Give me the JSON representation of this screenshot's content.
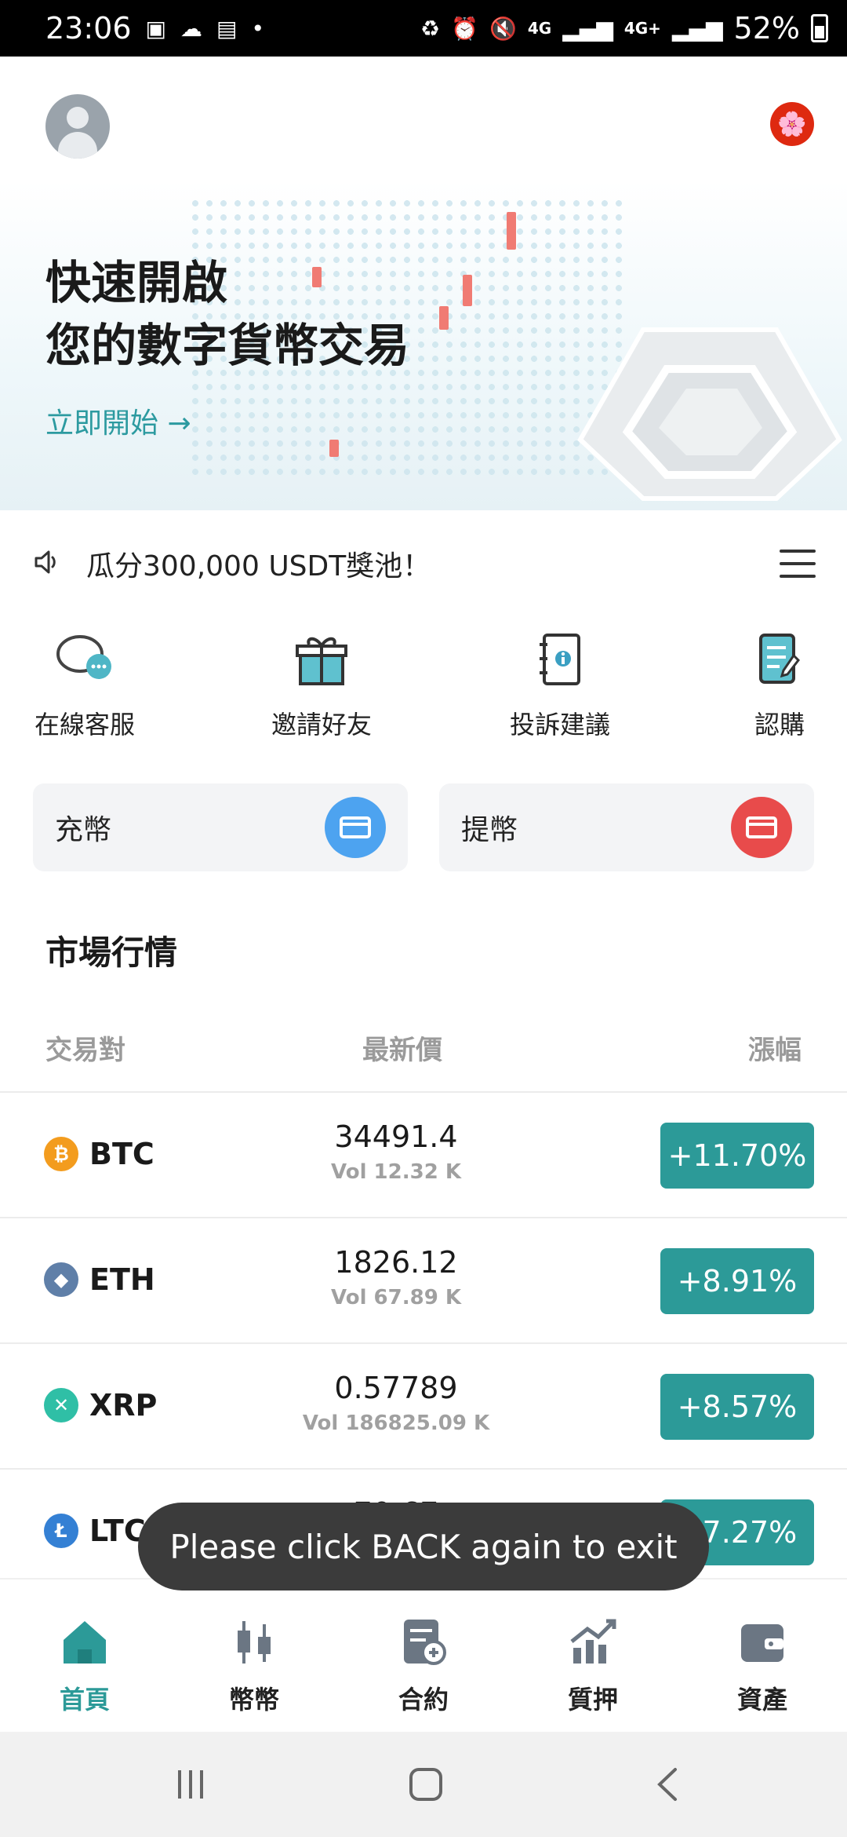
{
  "status_bar": {
    "time": "23:06",
    "network_4g": "4G",
    "network_4g_plus": "4G+",
    "battery": "52%",
    "icons": [
      "image-icon",
      "cloud-icon",
      "sim-icon",
      "dot-icon",
      "recycle-icon",
      "alarm-icon",
      "mute-icon",
      "signal-icon",
      "signal-icon",
      "battery-icon"
    ]
  },
  "header": {
    "avatar_icon": "user-avatar-icon",
    "region_flag": "🌸"
  },
  "banner": {
    "title_line1": "快速開啟",
    "title_line2": "您的數字貨幣交易",
    "cta": "立即開始 →"
  },
  "notice": {
    "text": "瓜分300,000 USDT獎池！",
    "icon": "speaker-icon"
  },
  "quick_actions": [
    {
      "label": "在線客服",
      "icon": "chat-icon"
    },
    {
      "label": "邀請好友",
      "icon": "gift-icon"
    },
    {
      "label": "投訴建議",
      "icon": "notebook-icon"
    },
    {
      "label": "認購",
      "icon": "document-icon"
    }
  ],
  "deposit": {
    "label": "充幣",
    "color": "#4da3f0"
  },
  "withdraw": {
    "label": "提幣",
    "color": "#e84b4b"
  },
  "market": {
    "title": "市場行情",
    "columns": {
      "pair": "交易對",
      "price": "最新價",
      "change": "漲幅"
    },
    "rows": [
      {
        "symbol": "BTC",
        "price": "34491.4",
        "volume": "Vol 12.32 K",
        "change": "+11.70%",
        "logo_color": "#f39c1e",
        "logo_glyph": "₿"
      },
      {
        "symbol": "ETH",
        "price": "1826.12",
        "volume": "Vol 67.89 K",
        "change": "+8.91%",
        "logo_color": "#5f7fa8",
        "logo_glyph": "◆"
      },
      {
        "symbol": "XRP",
        "price": "0.57789",
        "volume": "Vol 186825.09 K",
        "change": "+8.57%",
        "logo_color": "#2fbfa6",
        "logo_glyph": "✕"
      },
      {
        "symbol": "LTC",
        "price": "70.67",
        "volume": "",
        "change": "+7.27%",
        "logo_color": "#3480d4",
        "logo_glyph": "Ł"
      }
    ]
  },
  "toast": {
    "text": "Please click BACK again to exit"
  },
  "bottom_nav": [
    {
      "label": "首頁",
      "icon": "home-icon",
      "active": true
    },
    {
      "label": "幣幣",
      "icon": "candlestick-icon",
      "active": false
    },
    {
      "label": "合約",
      "icon": "contract-icon",
      "active": false
    },
    {
      "label": "質押",
      "icon": "chart-up-icon",
      "active": false
    },
    {
      "label": "資產",
      "icon": "wallet-icon",
      "active": false
    }
  ],
  "colors": {
    "accent": "#2c9a98",
    "link": "#2c9aa0"
  }
}
